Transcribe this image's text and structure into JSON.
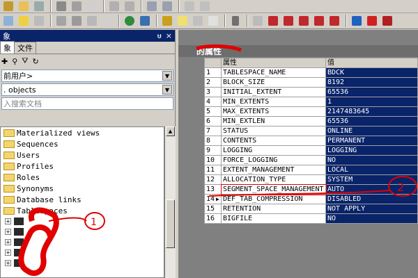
{
  "left_panel": {
    "title": "象",
    "pin_glyph": "ᵾ",
    "close_glyph": "×",
    "tabs": [
      "象",
      "文件"
    ],
    "active_tab": 0,
    "owner_combo": "前用户>",
    "type_combo": ". objects",
    "search_placeholder": "入搜索文档",
    "tree_items": [
      "Materialized views",
      "Sequences",
      "Users",
      "Profiles",
      "Roles",
      "Synonyms",
      "Database links",
      "Tablespaces"
    ]
  },
  "annotations": {
    "one": "1",
    "two": "2"
  },
  "right_panel": {
    "title": "的属性",
    "header": {
      "name": "属性",
      "value": "值"
    },
    "rows": [
      {
        "n": "1",
        "name": "TABLESPACE_NAME",
        "value": "BDCK"
      },
      {
        "n": "2",
        "name": "BLOCK_SIZE",
        "value": "8192"
      },
      {
        "n": "3",
        "name": "INITIAL_EXTENT",
        "value": "65536"
      },
      {
        "n": "4",
        "name": "MIN_EXTENTS",
        "value": "1"
      },
      {
        "n": "5",
        "name": "MAX_EXTENTS",
        "value": "2147483645"
      },
      {
        "n": "6",
        "name": "MIN_EXTLEN",
        "value": "65536"
      },
      {
        "n": "7",
        "name": "STATUS",
        "value": "ONLINE"
      },
      {
        "n": "8",
        "name": "CONTENTS",
        "value": "PERMANENT"
      },
      {
        "n": "9",
        "name": "LOGGING",
        "value": "LOGGING"
      },
      {
        "n": "10",
        "name": "FORCE_LOGGING",
        "value": "NO"
      },
      {
        "n": "11",
        "name": "EXTENT_MANAGEMENT",
        "value": "LOCAL"
      },
      {
        "n": "12",
        "name": "ALLOCATION_TYPE",
        "value": "SYSTEM"
      },
      {
        "n": "13",
        "name": "SEGMENT_SPACE_MANAGEMENT",
        "value": "AUTO"
      },
      {
        "n": "14",
        "name": "DEF_TAB_COMPRESSION",
        "value": "DISABLED"
      },
      {
        "n": "15",
        "name": "RETENTION",
        "value": "NOT APPLY"
      },
      {
        "n": "16",
        "name": "BIGFILE",
        "value": "NO"
      }
    ],
    "current_row_marker": "▶"
  },
  "colors": {
    "selection": "#0a246a",
    "annotation": "#e00000"
  }
}
